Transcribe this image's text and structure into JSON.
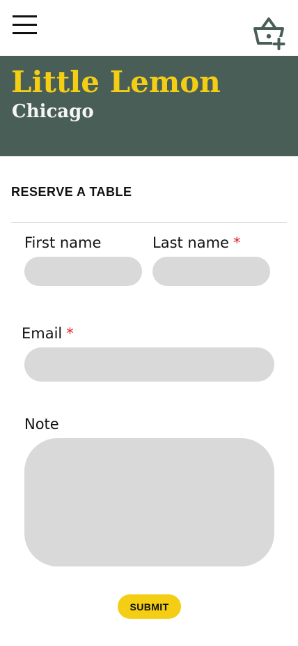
{
  "header": {
    "menu_icon": "hamburger-menu-icon",
    "basket_icon": "basket-add-icon"
  },
  "hero": {
    "title": "Little Lemon",
    "subtitle": "Chicago"
  },
  "form": {
    "heading": "RESERVE A TABLE",
    "first_name": {
      "label": "First name",
      "value": "",
      "required": false
    },
    "last_name": {
      "label": "Last name",
      "value": "",
      "required": true
    },
    "email": {
      "label": "Email",
      "value": "",
      "required": true
    },
    "note": {
      "label": "Note",
      "value": ""
    },
    "required_marker": "*",
    "submit_label": "SUBMIT"
  },
  "colors": {
    "brand_green": "#495e57",
    "brand_yellow": "#f4ce14",
    "field_gray": "#d9d9d9",
    "required_red": "#e02020"
  }
}
